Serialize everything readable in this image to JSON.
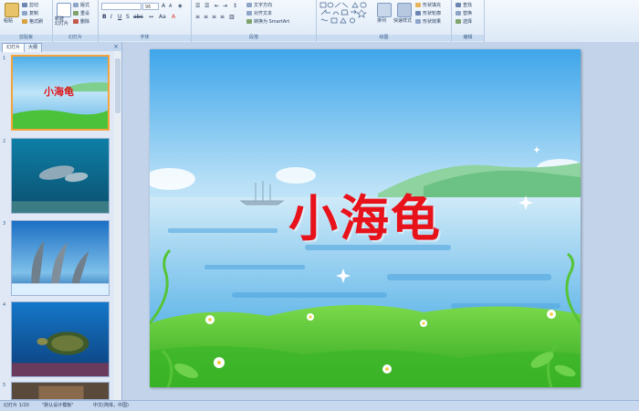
{
  "ribbon": {
    "clipboard": {
      "paste": "粘贴",
      "cut": "剪切",
      "copy": "复制",
      "format_painter": "格式刷",
      "label": "剪贴板"
    },
    "slides": {
      "new_slide": "新建\n幻灯片",
      "layout": "版式",
      "reset": "重设",
      "delete": "删除",
      "label": "幻灯片"
    },
    "font": {
      "font_size": "96",
      "label": "字体"
    },
    "paragraph": {
      "text_direction": "文字方向",
      "align_text": "对齐文本",
      "smartart": "转换为 SmartArt",
      "label": "段落"
    },
    "drawing": {
      "arrange": "排列",
      "quick_styles": "快速样式",
      "shape_fill": "形状填充",
      "shape_outline": "形状轮廓",
      "shape_effects": "形状效果",
      "label": "绘图"
    },
    "editing": {
      "find": "查找",
      "replace": "替换",
      "select": "选择",
      "label": "编辑"
    }
  },
  "pane": {
    "tabs": [
      "幻灯片",
      "大纲"
    ],
    "close": "×",
    "thumbnails": [
      {
        "num": "1",
        "title": "小海龟",
        "selected": true
      },
      {
        "num": "2",
        "title": ""
      },
      {
        "num": "3",
        "title": ""
      },
      {
        "num": "4",
        "title": ""
      },
      {
        "num": "5",
        "title": ""
      }
    ]
  },
  "slide": {
    "title": "小海龟"
  },
  "status": {
    "slide_info": "幻灯片 1/20",
    "theme": "\"默认设计模板\"",
    "language": "中文(简体，中国)"
  },
  "colors": {
    "title_red": "#e8121b",
    "selection_orange": "#f5a33b",
    "ribbon_blue": "#dde9f7"
  }
}
